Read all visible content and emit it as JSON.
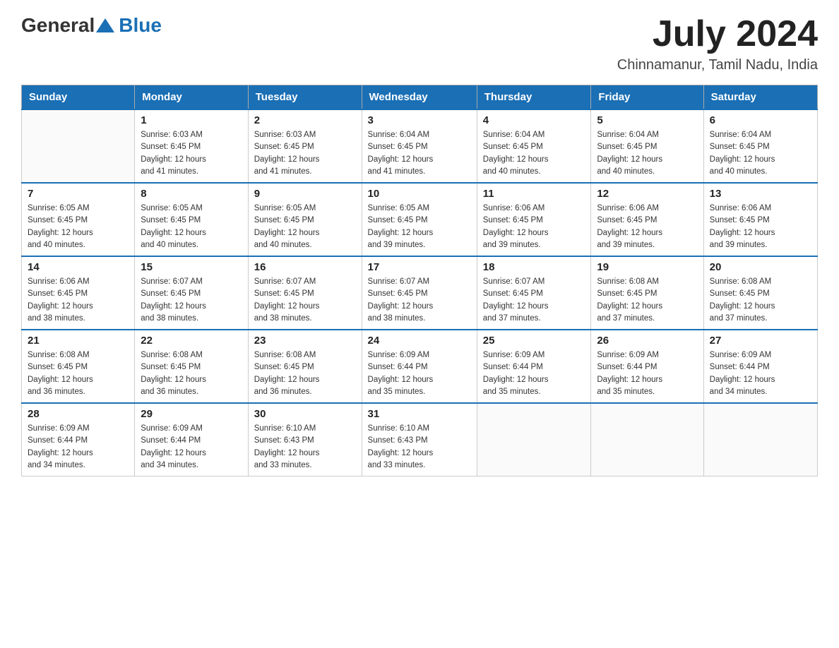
{
  "header": {
    "logo": {
      "general": "General",
      "blue": "Blue"
    },
    "month": "July 2024",
    "location": "Chinnamanur, Tamil Nadu, India"
  },
  "calendar": {
    "days_of_week": [
      "Sunday",
      "Monday",
      "Tuesday",
      "Wednesday",
      "Thursday",
      "Friday",
      "Saturday"
    ],
    "weeks": [
      [
        {
          "day": "",
          "info": ""
        },
        {
          "day": "1",
          "info": "Sunrise: 6:03 AM\nSunset: 6:45 PM\nDaylight: 12 hours\nand 41 minutes."
        },
        {
          "day": "2",
          "info": "Sunrise: 6:03 AM\nSunset: 6:45 PM\nDaylight: 12 hours\nand 41 minutes."
        },
        {
          "day": "3",
          "info": "Sunrise: 6:04 AM\nSunset: 6:45 PM\nDaylight: 12 hours\nand 41 minutes."
        },
        {
          "day": "4",
          "info": "Sunrise: 6:04 AM\nSunset: 6:45 PM\nDaylight: 12 hours\nand 40 minutes."
        },
        {
          "day": "5",
          "info": "Sunrise: 6:04 AM\nSunset: 6:45 PM\nDaylight: 12 hours\nand 40 minutes."
        },
        {
          "day": "6",
          "info": "Sunrise: 6:04 AM\nSunset: 6:45 PM\nDaylight: 12 hours\nand 40 minutes."
        }
      ],
      [
        {
          "day": "7",
          "info": "Sunrise: 6:05 AM\nSunset: 6:45 PM\nDaylight: 12 hours\nand 40 minutes."
        },
        {
          "day": "8",
          "info": "Sunrise: 6:05 AM\nSunset: 6:45 PM\nDaylight: 12 hours\nand 40 minutes."
        },
        {
          "day": "9",
          "info": "Sunrise: 6:05 AM\nSunset: 6:45 PM\nDaylight: 12 hours\nand 40 minutes."
        },
        {
          "day": "10",
          "info": "Sunrise: 6:05 AM\nSunset: 6:45 PM\nDaylight: 12 hours\nand 39 minutes."
        },
        {
          "day": "11",
          "info": "Sunrise: 6:06 AM\nSunset: 6:45 PM\nDaylight: 12 hours\nand 39 minutes."
        },
        {
          "day": "12",
          "info": "Sunrise: 6:06 AM\nSunset: 6:45 PM\nDaylight: 12 hours\nand 39 minutes."
        },
        {
          "day": "13",
          "info": "Sunrise: 6:06 AM\nSunset: 6:45 PM\nDaylight: 12 hours\nand 39 minutes."
        }
      ],
      [
        {
          "day": "14",
          "info": "Sunrise: 6:06 AM\nSunset: 6:45 PM\nDaylight: 12 hours\nand 38 minutes."
        },
        {
          "day": "15",
          "info": "Sunrise: 6:07 AM\nSunset: 6:45 PM\nDaylight: 12 hours\nand 38 minutes."
        },
        {
          "day": "16",
          "info": "Sunrise: 6:07 AM\nSunset: 6:45 PM\nDaylight: 12 hours\nand 38 minutes."
        },
        {
          "day": "17",
          "info": "Sunrise: 6:07 AM\nSunset: 6:45 PM\nDaylight: 12 hours\nand 38 minutes."
        },
        {
          "day": "18",
          "info": "Sunrise: 6:07 AM\nSunset: 6:45 PM\nDaylight: 12 hours\nand 37 minutes."
        },
        {
          "day": "19",
          "info": "Sunrise: 6:08 AM\nSunset: 6:45 PM\nDaylight: 12 hours\nand 37 minutes."
        },
        {
          "day": "20",
          "info": "Sunrise: 6:08 AM\nSunset: 6:45 PM\nDaylight: 12 hours\nand 37 minutes."
        }
      ],
      [
        {
          "day": "21",
          "info": "Sunrise: 6:08 AM\nSunset: 6:45 PM\nDaylight: 12 hours\nand 36 minutes."
        },
        {
          "day": "22",
          "info": "Sunrise: 6:08 AM\nSunset: 6:45 PM\nDaylight: 12 hours\nand 36 minutes."
        },
        {
          "day": "23",
          "info": "Sunrise: 6:08 AM\nSunset: 6:45 PM\nDaylight: 12 hours\nand 36 minutes."
        },
        {
          "day": "24",
          "info": "Sunrise: 6:09 AM\nSunset: 6:44 PM\nDaylight: 12 hours\nand 35 minutes."
        },
        {
          "day": "25",
          "info": "Sunrise: 6:09 AM\nSunset: 6:44 PM\nDaylight: 12 hours\nand 35 minutes."
        },
        {
          "day": "26",
          "info": "Sunrise: 6:09 AM\nSunset: 6:44 PM\nDaylight: 12 hours\nand 35 minutes."
        },
        {
          "day": "27",
          "info": "Sunrise: 6:09 AM\nSunset: 6:44 PM\nDaylight: 12 hours\nand 34 minutes."
        }
      ],
      [
        {
          "day": "28",
          "info": "Sunrise: 6:09 AM\nSunset: 6:44 PM\nDaylight: 12 hours\nand 34 minutes."
        },
        {
          "day": "29",
          "info": "Sunrise: 6:09 AM\nSunset: 6:44 PM\nDaylight: 12 hours\nand 34 minutes."
        },
        {
          "day": "30",
          "info": "Sunrise: 6:10 AM\nSunset: 6:43 PM\nDaylight: 12 hours\nand 33 minutes."
        },
        {
          "day": "31",
          "info": "Sunrise: 6:10 AM\nSunset: 6:43 PM\nDaylight: 12 hours\nand 33 minutes."
        },
        {
          "day": "",
          "info": ""
        },
        {
          "day": "",
          "info": ""
        },
        {
          "day": "",
          "info": ""
        }
      ]
    ]
  }
}
